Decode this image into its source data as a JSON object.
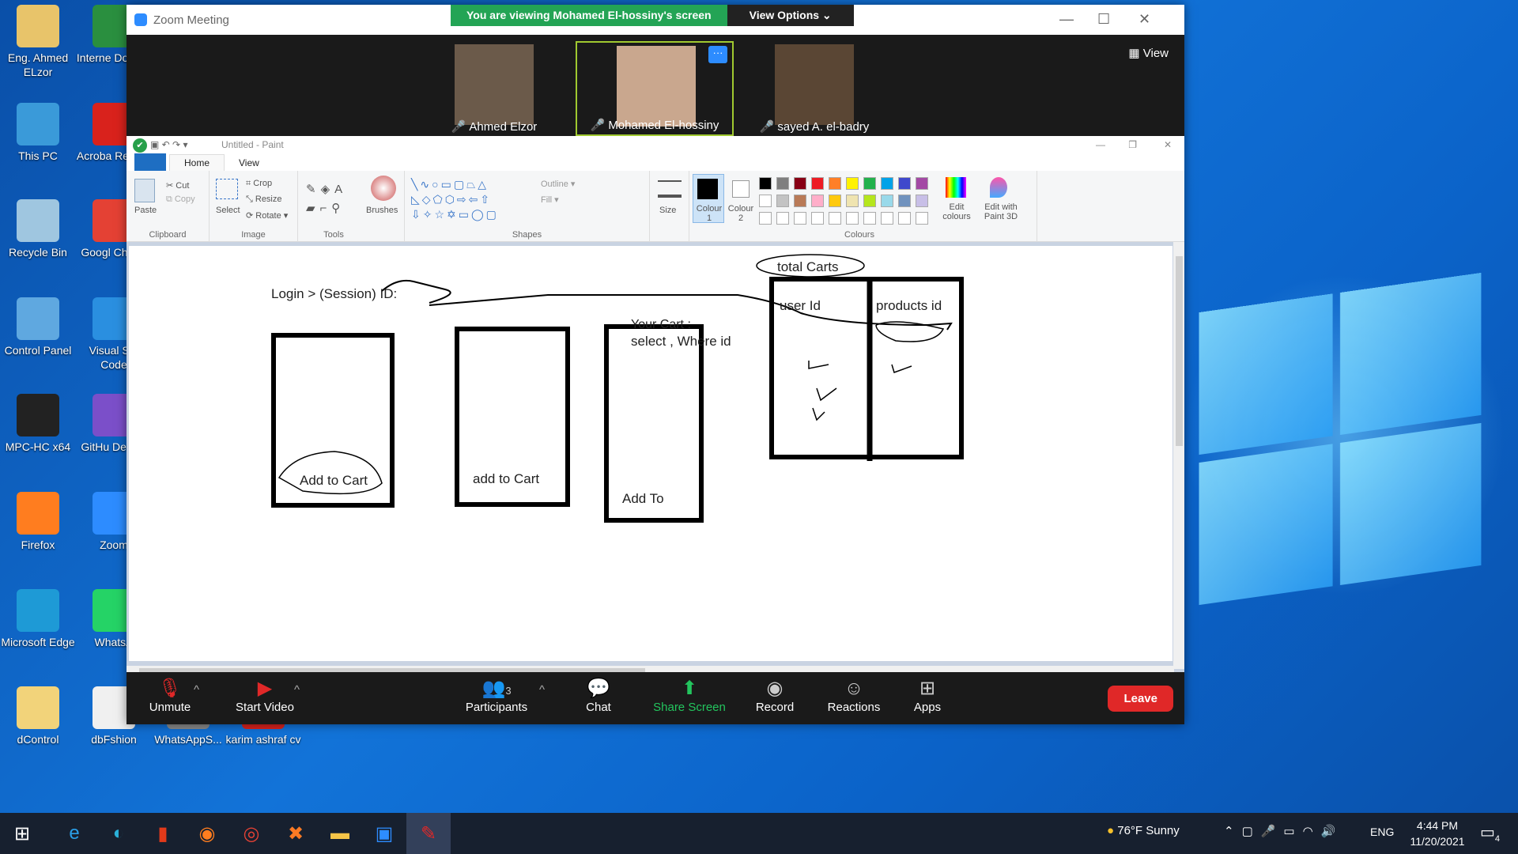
{
  "desktop": {
    "icons": [
      {
        "label": "Eng. Ahmed ELzor",
        "icon": "person-folder-icon",
        "color": "#e8c46a"
      },
      {
        "label": "Interne Downlo",
        "icon": "globe-icon",
        "color": "#2a8f3f"
      },
      {
        "label": "This PC",
        "icon": "monitor-icon",
        "color": "#3a9ad9"
      },
      {
        "label": "Acroba Reader",
        "icon": "pdf-icon",
        "color": "#d9221c"
      },
      {
        "label": "Recycle Bin",
        "icon": "recycle-bin-icon",
        "color": "#9fc6e0"
      },
      {
        "label": "Googl Chrom",
        "icon": "chrome-icon",
        "color": "#e44134"
      },
      {
        "label": "Control Panel",
        "icon": "control-panel-icon",
        "color": "#5fa8e0"
      },
      {
        "label": "Visual Stu Code",
        "icon": "vscode-icon",
        "color": "#2a8fe0"
      },
      {
        "label": "MPC-HC x64",
        "icon": "media-player-icon",
        "color": "#222222"
      },
      {
        "label": "GitHu Deskto",
        "icon": "github-icon",
        "color": "#7b4fc9"
      },
      {
        "label": "Firefox",
        "icon": "firefox-icon",
        "color": "#ff7d1f"
      },
      {
        "label": "Zoom",
        "icon": "zoom-icon",
        "color": "#2d8cff"
      },
      {
        "label": "Microsoft Edge",
        "icon": "edge-icon",
        "color": "#1e9ad6"
      },
      {
        "label": "WhatsA",
        "icon": "whatsapp-icon",
        "color": "#25d366"
      },
      {
        "label": "dControl",
        "icon": "dcontrol-icon",
        "color": "#f2d37a"
      },
      {
        "label": "dbFshion",
        "icon": "json-file-icon",
        "color": "#f0f0f0"
      },
      {
        "label": "WhatsAppS...",
        "icon": "image-file-icon",
        "color": "#888888"
      },
      {
        "label": "karim ashraf cv",
        "icon": "pdf-file-icon",
        "color": "#d9221c"
      }
    ]
  },
  "zoom": {
    "title": "Zoom Meeting",
    "banner": "You are viewing Mohamed El-hossiny's screen",
    "view_options": "View Options ⌄",
    "view": "View",
    "participants": [
      {
        "name": "Ahmed Elzor",
        "color": "#6b5a4a"
      },
      {
        "name": "Mohamed El-hossiny",
        "color": "#c9a78e"
      },
      {
        "name": "sayed A. el-badry",
        "color": "#5a4634"
      }
    ],
    "controls": {
      "unmute": "Unmute",
      "video": "Start Video",
      "participants": "Participants",
      "participants_count": "3",
      "chat": "Chat",
      "share": "Share Screen",
      "record": "Record",
      "reactions": "Reactions",
      "apps": "Apps",
      "leave": "Leave"
    }
  },
  "paint": {
    "title": "Untitled - Paint",
    "tabs": {
      "home": "Home",
      "view": "View"
    },
    "clipboard": {
      "paste": "Paste",
      "cut": "Cut",
      "copy": "Copy",
      "label": "Clipboard"
    },
    "image": {
      "select": "Select",
      "crop": "Crop",
      "resize": "Resize",
      "rotate": "Rotate ▾",
      "label": "Image"
    },
    "tools": {
      "label": "Tools",
      "brushes": "Brushes"
    },
    "shapes": {
      "label": "Shapes",
      "outline": "Outline ▾",
      "fill": "Fill ▾"
    },
    "size": "Size",
    "colour1": "Colour 1",
    "colour2": "Colour 2",
    "colours_label": "Colours",
    "edit_colours": "Edit colours",
    "edit_paint3d": "Edit with Paint 3D",
    "palette": [
      "#000000",
      "#7f7f7f",
      "#880015",
      "#ed1c24",
      "#ff7f27",
      "#fff200",
      "#22b14c",
      "#00a2e8",
      "#3f48cc",
      "#a349a4",
      "#ffffff",
      "#c3c3c3",
      "#b97a57",
      "#ffaec9",
      "#ffc90e",
      "#efe4b0",
      "#b5e61d",
      "#99d9ea",
      "#7092be",
      "#c8bfe7"
    ],
    "drawing": {
      "login": "Login > (Session) ID:",
      "add_to_cart_1": "Add to Cart",
      "add_to_cart_2": "add to Cart",
      "your_cart": "Your Cart :",
      "select_where": "select , Where id",
      "add_to": "Add To",
      "total_carts": "total Carts",
      "user_id": "user Id",
      "products_id": "products id"
    }
  },
  "taskbar": {
    "weather": "76°F  Sunny",
    "lang": "ENG",
    "time": "4:44 PM",
    "date": "11/20/2021",
    "notifications": "4"
  }
}
